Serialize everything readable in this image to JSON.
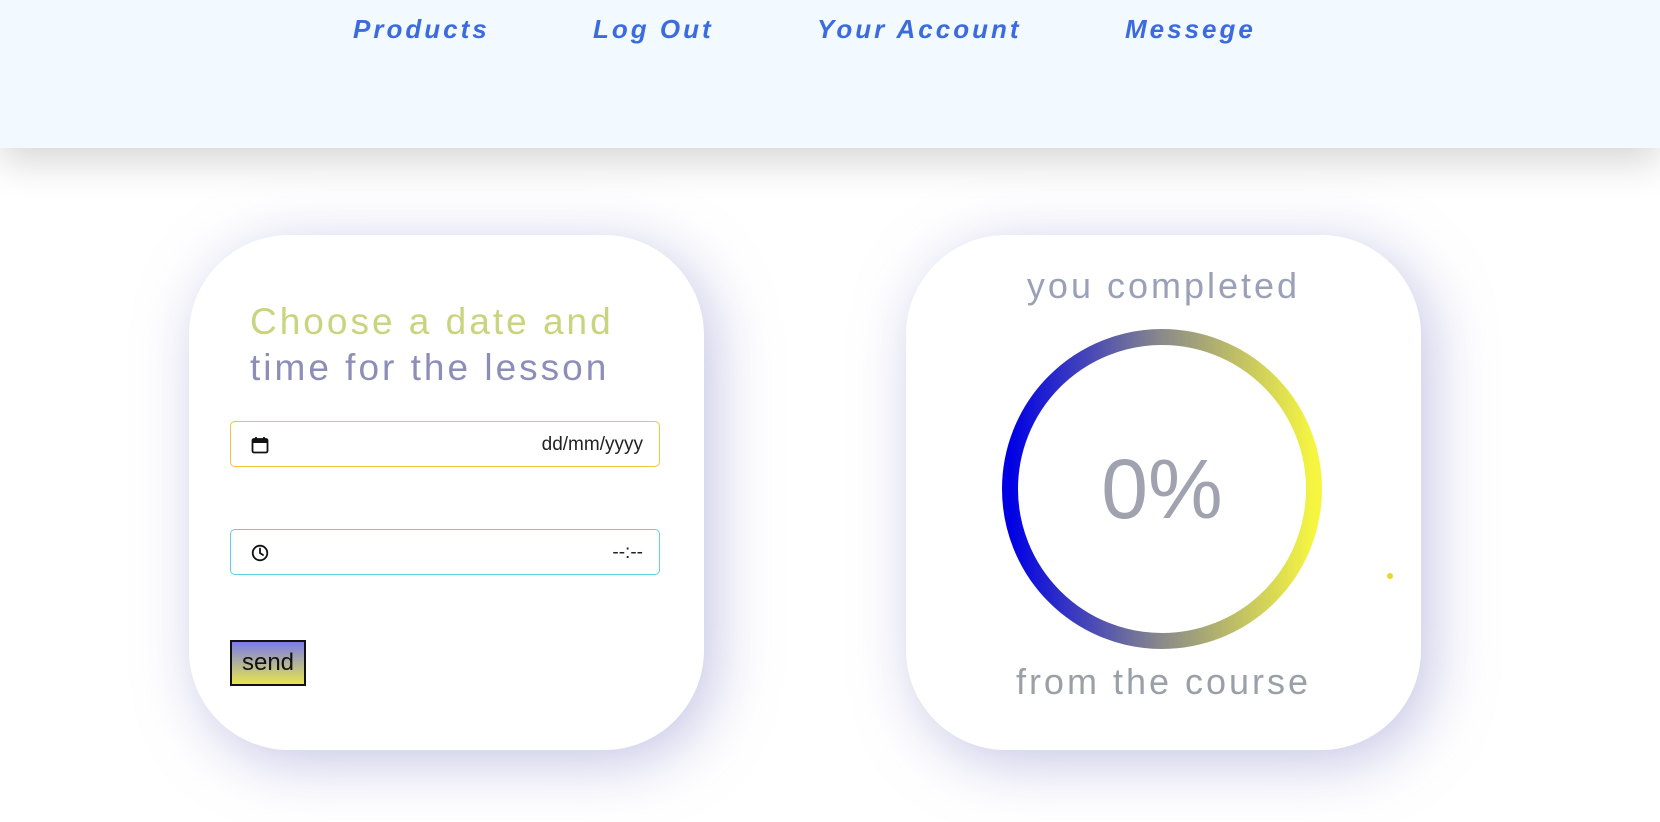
{
  "nav": {
    "items": [
      {
        "label": "Products"
      },
      {
        "label": "Log Out"
      },
      {
        "label": "Your Account"
      },
      {
        "label": "Messege"
      }
    ]
  },
  "lesson_form": {
    "title_line1": "Choose a date and",
    "title_line2": "time for the lesson",
    "date_value": "dd/mm/yyyy",
    "time_value": "--:--",
    "send_label": "send"
  },
  "progress": {
    "top_text": "you completed",
    "percent_text": "0%",
    "percent": 0,
    "bottom_text": "from the course"
  },
  "colors": {
    "nav_link": "#3c6be0",
    "header_bg": "#f2f9ff",
    "title_line1": "#c8d47e",
    "title_line2": "#8c8eb8",
    "date_border": "#f2c63c",
    "time_border": "#62d0e0",
    "ring_start": "#0000e6",
    "ring_end": "#f6f640"
  },
  "icons": {
    "date_field": "calendar-icon",
    "time_field": "clock-icon"
  }
}
